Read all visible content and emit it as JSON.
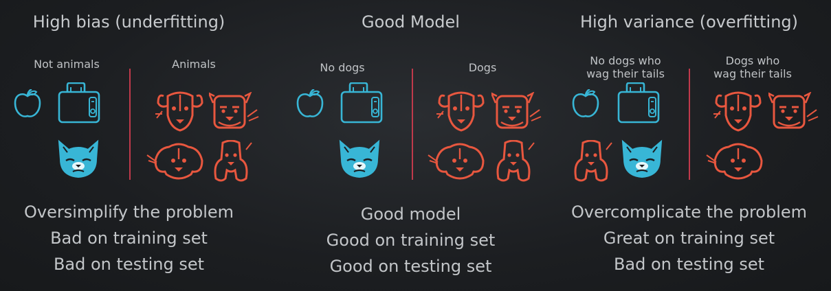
{
  "colors": {
    "blue": "#38b6d6",
    "red": "#e8573f",
    "divider": "#c0394b"
  },
  "panels": [
    {
      "title": "High bias (underfitting)",
      "left_header": "Not animals",
      "right_header": "Animals",
      "left_icons": [
        "apple-icon",
        "toaster-icon",
        "grumpy-cat-icon"
      ],
      "right_icons": [
        "dog-icon",
        "terrier-icon",
        "beagle-icon",
        "spaniel-icon"
      ],
      "captions": [
        "Oversimplify the problem",
        "Bad on training set",
        "Bad on testing set"
      ]
    },
    {
      "title": "Good Model",
      "left_header": "No dogs",
      "right_header": "Dogs",
      "left_icons": [
        "apple-icon",
        "toaster-icon",
        "grumpy-cat-icon"
      ],
      "right_icons": [
        "dog-icon",
        "terrier-icon",
        "beagle-icon",
        "spaniel-icon"
      ],
      "captions": [
        "Good model",
        "Good on training set",
        "Good on testing set"
      ]
    },
    {
      "title": "High variance (overfitting)",
      "left_header": "No dogs who\nwag their tails",
      "right_header": "Dogs who\nwag their tails",
      "left_icons": [
        "apple-icon",
        "toaster-icon",
        "spaniel-icon",
        "grumpy-cat-icon"
      ],
      "right_icons": [
        "dog-icon",
        "terrier-icon",
        "beagle-icon"
      ],
      "captions": [
        "Overcomplicate the problem",
        "Great on training set",
        "Bad on testing set"
      ]
    }
  ]
}
